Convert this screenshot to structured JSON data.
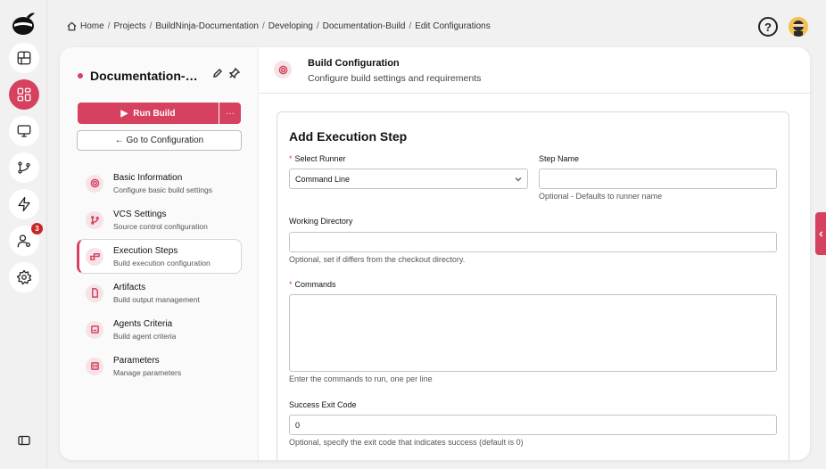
{
  "breadcrumb": [
    "Home",
    "Projects",
    "BuildNinja-Documentation",
    "Developing",
    "Documentation-Build",
    "Edit Configurations"
  ],
  "rail": {
    "items": [
      {
        "name": "dashboard-icon"
      },
      {
        "name": "projects-icon",
        "active": true
      },
      {
        "name": "monitor-icon"
      },
      {
        "name": "vcs-icon"
      },
      {
        "name": "lightning-icon"
      },
      {
        "name": "users-icon",
        "badge": "3"
      },
      {
        "name": "settings-icon"
      }
    ]
  },
  "build": {
    "name": "Documentation-Build",
    "run_label": "Run Build",
    "more_label": "···",
    "goto_label": "← Go to Configuration"
  },
  "nav": [
    {
      "label": "Basic Information",
      "desc": "Configure basic build settings",
      "icon": "gear-icon"
    },
    {
      "label": "VCS Settings",
      "desc": "Source control configuration",
      "icon": "branch-icon"
    },
    {
      "label": "Execution Steps",
      "desc": "Build execution configuration",
      "icon": "steps-icon",
      "active": true
    },
    {
      "label": "Artifacts",
      "desc": "Build output management",
      "icon": "file-icon"
    },
    {
      "label": "Agents Criteria",
      "desc": "Build agent criteria",
      "icon": "agent-icon"
    },
    {
      "label": "Parameters",
      "desc": "Manage parameters",
      "icon": "sliders-icon"
    }
  ],
  "panel": {
    "title": "Build Configuration",
    "subtitle": "Configure build settings and requirements"
  },
  "form": {
    "title": "Add Execution Step",
    "runner_label": "Select Runner",
    "runner_value": "Command Line",
    "step_name_label": "Step Name",
    "step_name_value": "",
    "step_name_help": "Optional - Defaults to runner name",
    "workdir_label": "Working Directory",
    "workdir_value": "",
    "workdir_help": "Optional, set if differs from the checkout directory.",
    "commands_label": "Commands",
    "commands_value": "",
    "commands_help": "Enter the commands to run, one per line",
    "exit_label": "Success Exit Code",
    "exit_value": "0",
    "exit_help": "Optional, specify the exit code that indicates success (default is 0)"
  },
  "colors": {
    "accent": "#d6415f",
    "badge": "#c62828"
  }
}
